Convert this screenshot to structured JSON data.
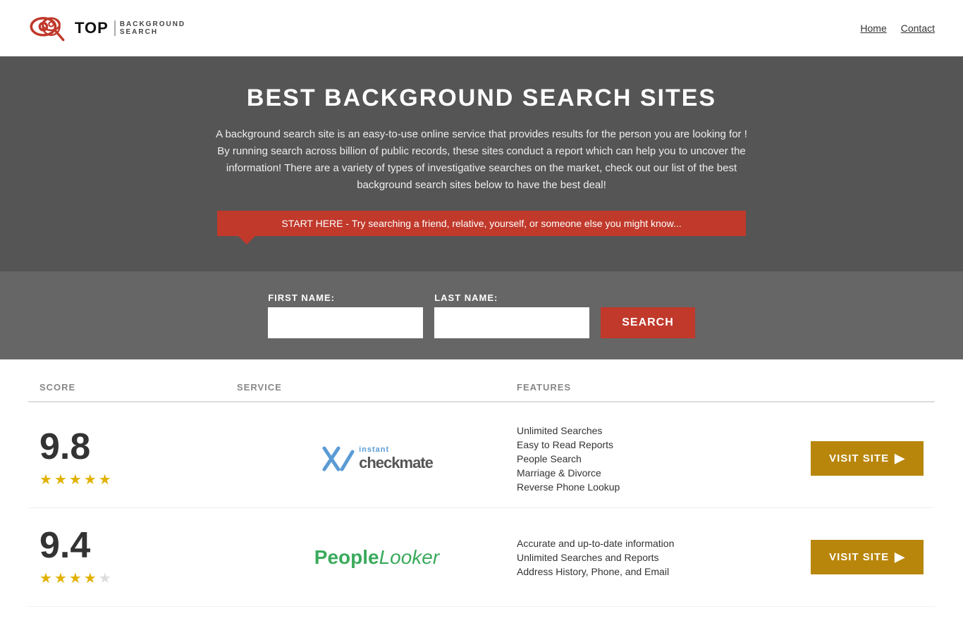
{
  "header": {
    "logo_top": "TOP",
    "logo_sub_line1": "BACKGROUND",
    "logo_sub_line2": "SEARCH",
    "nav": {
      "home": "Home",
      "contact": "Contact"
    }
  },
  "hero": {
    "title": "BEST BACKGROUND SEARCH SITES",
    "description": "A background search site is an easy-to-use online service that provides results  for the person you are looking for ! By  running  search across billion of public records, these sites conduct  a report which can help you to uncover the information! There are a variety of types of investigative searches on the market, check out our  list of the best background search sites below to have the best deal!",
    "callout": "START HERE - Try searching a friend, relative, yourself, or someone else you might know..."
  },
  "search_form": {
    "first_name_label": "FIRST NAME:",
    "last_name_label": "LAST NAME:",
    "first_name_placeholder": "",
    "last_name_placeholder": "",
    "search_button": "SEARCH"
  },
  "table": {
    "headers": {
      "score": "SCORE",
      "service": "SERVICE",
      "features": "FEATURES",
      "action": ""
    },
    "rows": [
      {
        "score": "9.8",
        "stars": 4.5,
        "service_name": "Instant Checkmate",
        "features": [
          "Unlimited Searches",
          "Easy to Read Reports",
          "People Search",
          "Marriage & Divorce",
          "Reverse Phone Lookup"
        ],
        "visit_label": "VISIT SITE"
      },
      {
        "score": "9.4",
        "stars": 4,
        "service_name": "PeopleLooker",
        "features": [
          "Accurate and up-to-date information",
          "Unlimited Searches and Reports",
          "Address History, Phone, and Email"
        ],
        "visit_label": "VISIT SITE"
      }
    ]
  }
}
